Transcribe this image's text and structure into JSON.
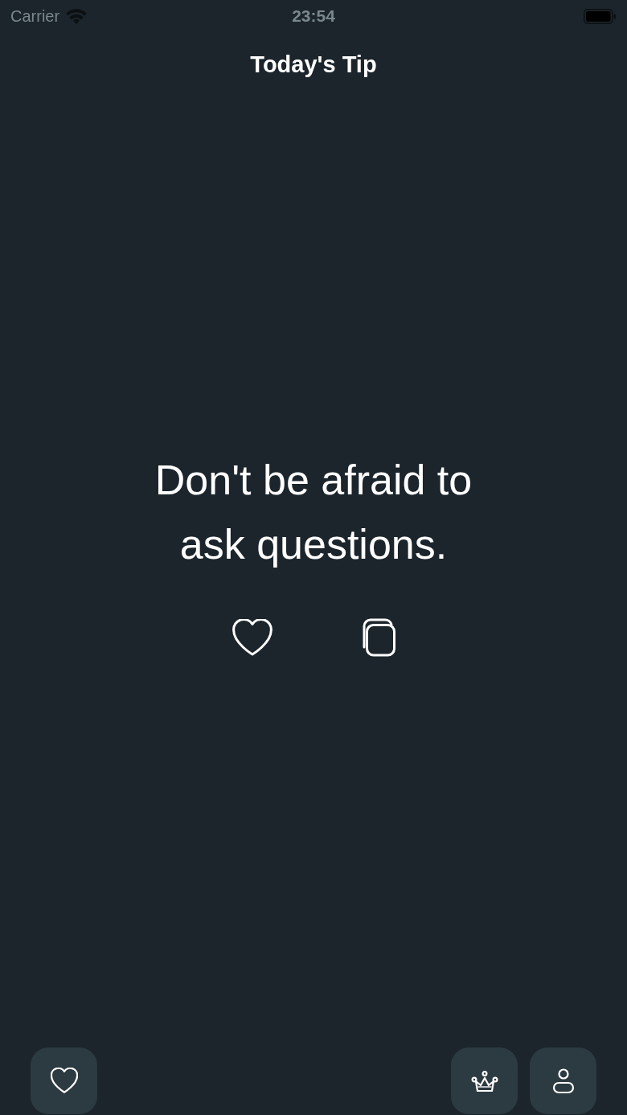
{
  "status_bar": {
    "carrier": "Carrier",
    "time": "23:54"
  },
  "header": {
    "title": "Today's Tip"
  },
  "tip": {
    "text": "Don't be afraid to ask questions."
  }
}
